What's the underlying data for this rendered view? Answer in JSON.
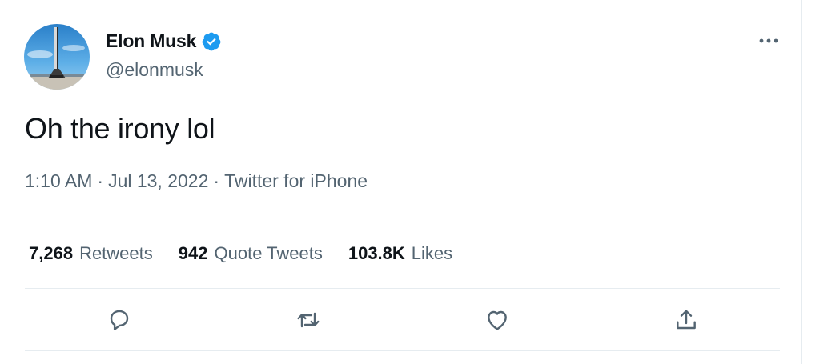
{
  "user": {
    "name": "Elon Musk",
    "handle": "@elonmusk",
    "verified": true,
    "avatar_icon": "rocket-launchpad-avatar"
  },
  "tweet": {
    "text": "Oh the irony lol",
    "time": "1:10 AM",
    "date": "Jul 13, 2022",
    "source": "Twitter for iPhone",
    "sep": "·"
  },
  "stats": {
    "retweets": {
      "num": "7,268",
      "label": "Retweets"
    },
    "quotes": {
      "num": "942",
      "label": "Quote Tweets"
    },
    "likes": {
      "num": "103.8K",
      "label": "Likes"
    }
  },
  "actions": [
    "reply-icon",
    "retweet-icon",
    "like-icon",
    "share-icon"
  ],
  "colors": {
    "primary_text": "#0f1419",
    "secondary_text": "#536471",
    "verified_blue": "#1d9bf0",
    "divider": "#e6ecf0"
  }
}
